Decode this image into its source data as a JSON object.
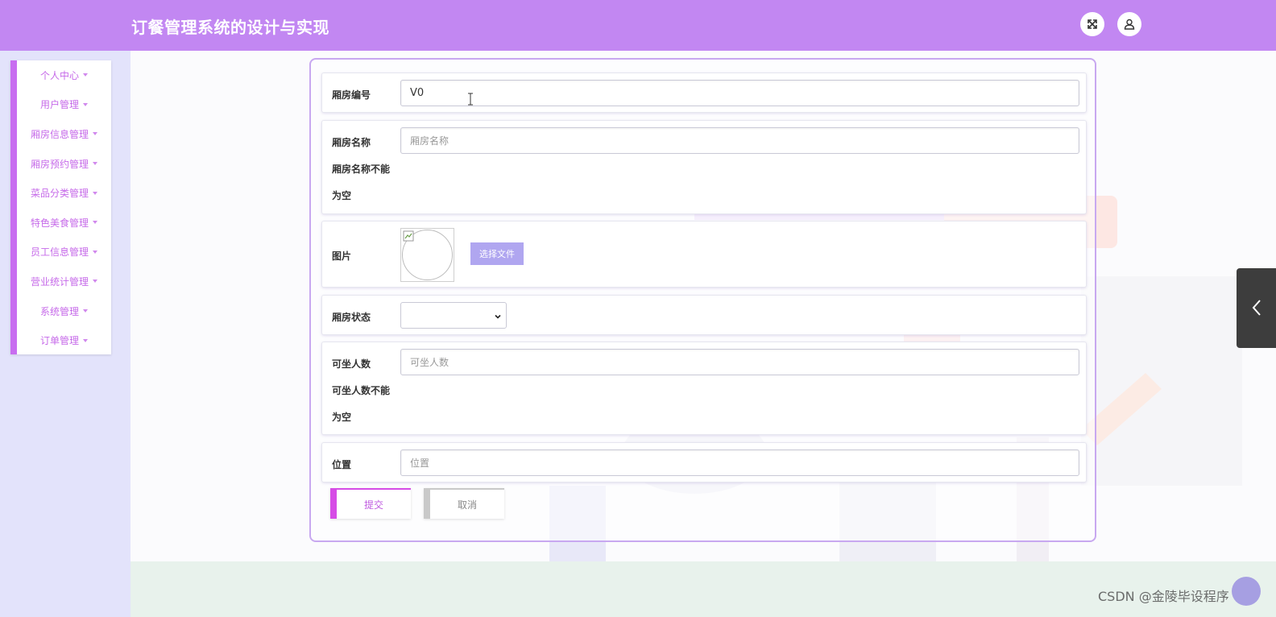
{
  "header": {
    "title": "订餐管理系统的设计与实现",
    "fullscreen_icon": "expand-arrows-icon",
    "user_icon": "user-icon"
  },
  "sidebar": {
    "items": [
      {
        "label": "个人中心"
      },
      {
        "label": "用户管理"
      },
      {
        "label": "厢房信息管理"
      },
      {
        "label": "厢房预约管理"
      },
      {
        "label": "菜品分类管理"
      },
      {
        "label": "特色美食管理"
      },
      {
        "label": "员工信息管理"
      },
      {
        "label": "营业统计管理"
      },
      {
        "label": "系统管理"
      },
      {
        "label": "订单管理"
      }
    ]
  },
  "form": {
    "room_no": {
      "label": "厢房编号",
      "value": "V0"
    },
    "room_name": {
      "label": "厢房名称",
      "placeholder": "厢房名称",
      "error_line1": "厢房名称不能",
      "error_line2": "为空"
    },
    "image": {
      "label": "图片",
      "button": "选择文件"
    },
    "status": {
      "label": "厢房状态",
      "value": ""
    },
    "capacity": {
      "label": "可坐人数",
      "placeholder": "可坐人数",
      "error_line1": "可坐人数不能",
      "error_line2": "为空"
    },
    "location": {
      "label": "位置",
      "placeholder": "位置"
    },
    "submit": "提交",
    "cancel": "取消"
  },
  "watermark": "CSDN @金陵毕设程序",
  "colors": {
    "header": "#c287f2",
    "sidebar_bg": "#e3e3fb",
    "accent": "#c86ef0",
    "file_button": "#b0a6f0"
  }
}
